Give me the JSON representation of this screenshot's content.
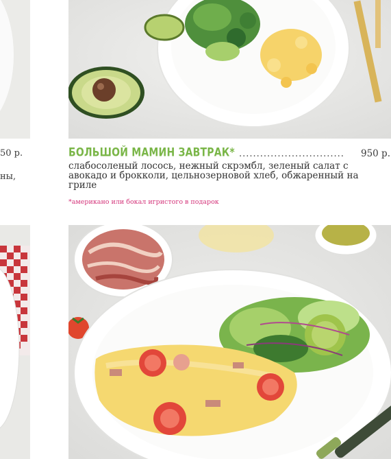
{
  "left_column": {
    "price_fragment": "50 р.",
    "desc_fragment": "ны,"
  },
  "dish": {
    "title": "БОЛЬШОЙ МАМИН ЗАВТРАК*",
    "dots": "..............................",
    "price": "950 р.",
    "description": "слабосоленый лосось, нежный скрэмбл, зеленый салат с авокадо и брокколи, цельнозерновой хлеб, обжаренный на гриле",
    "note": "*американо или бокал игристого в подарок"
  },
  "colors": {
    "title_green": "#7ab648",
    "note_pink": "#d4347a"
  }
}
